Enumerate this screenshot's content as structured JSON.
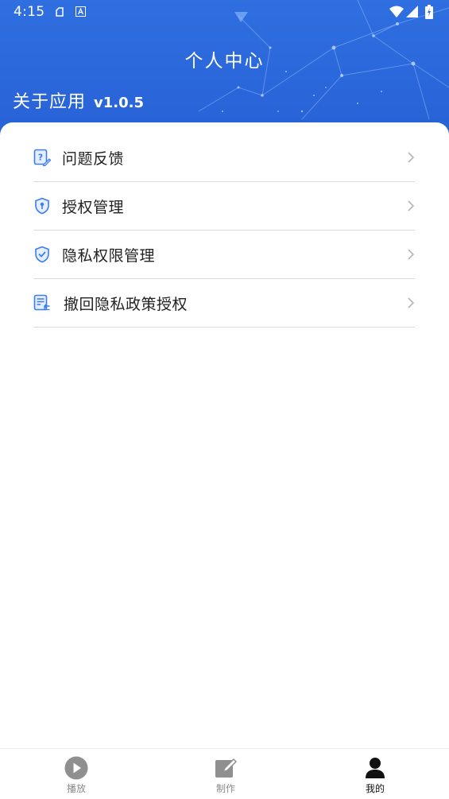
{
  "status_bar": {
    "time": "4:15",
    "icons": [
      "notification-icon",
      "font-icon",
      "wifi-icon",
      "signal-icon",
      "battery-icon"
    ]
  },
  "header": {
    "title": "个人中心",
    "about_label": "关于应用",
    "version": "v1.0.5",
    "background_color": "#2f6fe0"
  },
  "menu": {
    "items": [
      {
        "label": "问题反馈",
        "icon": "feedback-icon"
      },
      {
        "label": "授权管理",
        "icon": "shield-key-icon"
      },
      {
        "label": "隐私权限管理",
        "icon": "shield-check-icon"
      },
      {
        "label": "撤回隐私政策授权",
        "icon": "document-revoke-icon"
      }
    ],
    "accent_color": "#3b7cf0"
  },
  "tabbar": {
    "tabs": [
      {
        "label": "播放",
        "icon": "play-icon",
        "active": false
      },
      {
        "label": "制作",
        "icon": "edit-icon",
        "active": false
      },
      {
        "label": "我的",
        "icon": "person-icon",
        "active": true
      }
    ]
  }
}
